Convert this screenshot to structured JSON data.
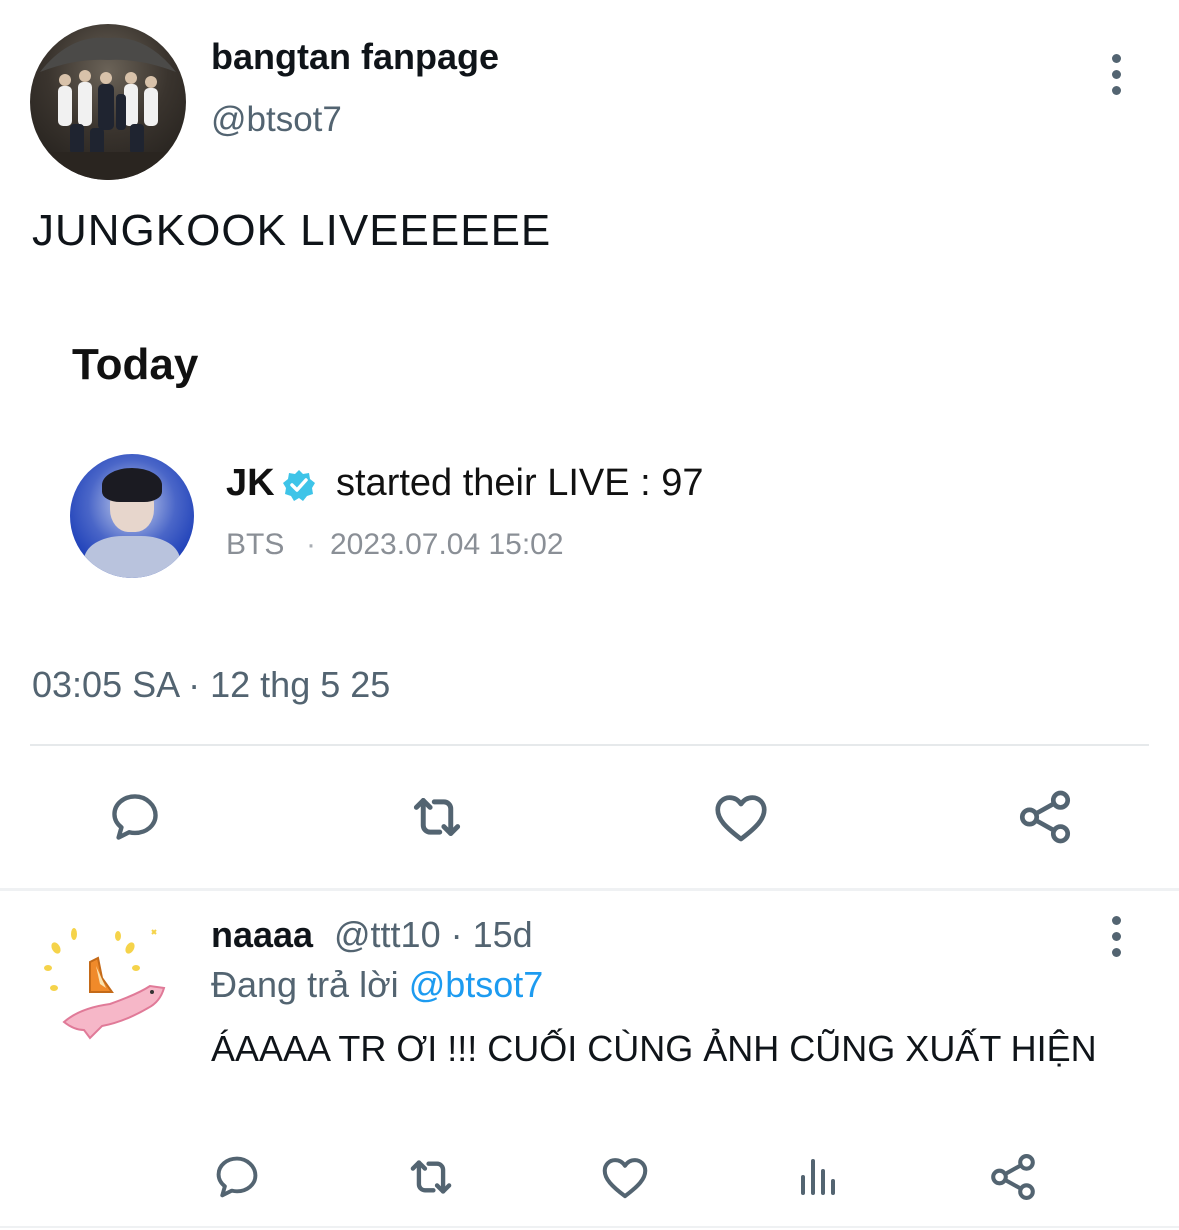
{
  "tweet": {
    "display_name": "bangtan fanpage",
    "handle": "@btsot7",
    "text": "JUNGKOOK LIVEEEEEE",
    "timestamp": "03:05 SA · 12 thg 5 25"
  },
  "embedded_card": {
    "heading": "Today",
    "user": "JK",
    "action_text": "started their LIVE : 97",
    "community": "BTS",
    "separator": "·",
    "datetime": "2023.07.04 15:02"
  },
  "actions": {
    "icons": [
      "reply-icon",
      "retweet-icon",
      "like-icon",
      "share-icon",
      "views-icon"
    ]
  },
  "reply": {
    "display_name": "naaaa",
    "meta": "@ttt10 · 15d",
    "replying_prefix": "Đang trả lời",
    "replying_handle": "@btsot7",
    "text": "ÁAAAA TR ƠI !!! CUỐI CÙNG ẢNH CŨNG XUẤT HIỆN"
  },
  "colors": {
    "text_primary": "#0f1419",
    "text_secondary": "#536471",
    "mention_blue": "#1d9bf0",
    "verified_blue": "#3ec4e8"
  }
}
